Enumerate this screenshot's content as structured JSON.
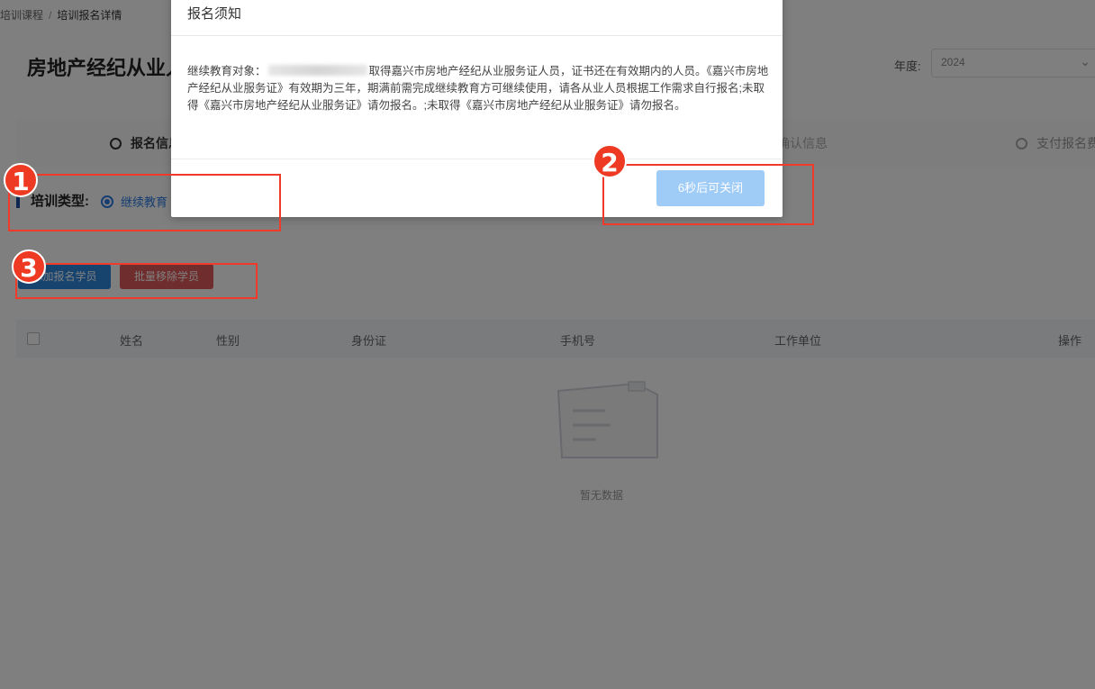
{
  "breadcrumb": {
    "parent": "培训课程",
    "current": "培训报名详情"
  },
  "page": {
    "title": "房地产经纪从业人员"
  },
  "filter": {
    "year_label": "年度:",
    "year_value": "2024"
  },
  "steps": [
    {
      "label": "报名信息"
    },
    {
      "label": "确认信息"
    },
    {
      "label": "支付报名费"
    }
  ],
  "training": {
    "label": "培训类型:",
    "option": "继续教育"
  },
  "actions": {
    "add_label": "添加报名学员",
    "remove_label": "批量移除学员"
  },
  "table": {
    "headers": [
      "姓名",
      "性别",
      "身份证",
      "手机号",
      "工作单位",
      "操作"
    ],
    "empty_text": "暂无数据"
  },
  "dialog": {
    "title": "报名须知",
    "body_prefix": "继续教育对象：",
    "body_after_blur": "取得嘉兴市房地产经纪从业服务证人员，证书还在有效期内的人员。《嘉兴市房地产经纪从业服务证》有效期为三年，期满前需完成继续教育方可继续使用，请各从业人员根据工作需求自行报名;未取得《嘉兴市房地产经纪从业服务证》请勿报名。;未取得《嘉兴市房地产经纪从业服务证》请勿报名。",
    "close_label": "6秒后可关闭"
  },
  "annotations": [
    {
      "number": "1"
    },
    {
      "number": "2"
    },
    {
      "number": "3"
    }
  ],
  "colors": {
    "annotation_red": "#ee3a22",
    "primary_blue": "#2e86de",
    "danger_red": "#e05a5a",
    "disabled_blue": "#9fcbf7"
  }
}
